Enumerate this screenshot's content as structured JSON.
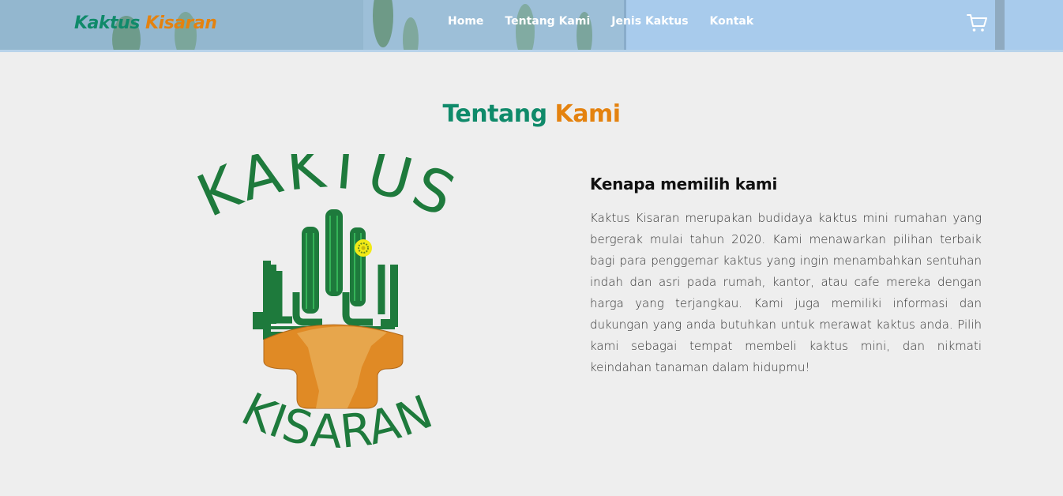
{
  "navbar": {
    "brand_part1": "Kaktus",
    "brand_part2": "Kisaran",
    "links": [
      "Home",
      "Tentang Kami",
      "Jenis Kaktus",
      "Kontak"
    ],
    "cart_icon": "cart-icon"
  },
  "about": {
    "title_part1": "Tentang",
    "title_part2": "Kami",
    "logo": {
      "top_text": "KAKTUS",
      "bottom_text": "KISARAN"
    },
    "heading": "Kenapa memilih kami",
    "paragraph": "Kaktus Kisaran merupakan budidaya kaktus mini rumahan yang bergerak mulai tahun 2020. Kami menawarkan pilihan terbaik bagi para penggemar kaktus yang ingin menambahkan sentuhan indah dan asri pada rumah, kantor, atau cafe mereka dengan harga yang terjangkau. Kami juga memiliki informasi dan dukungan yang anda butuhkan untuk merawat kaktus anda. Pilih kami sebagai tempat membeli kaktus mini, dan nikmati keindahan tanaman dalam hidupmu!"
  },
  "colors": {
    "green": "#0f8a6a",
    "orange": "#e4820f",
    "logo_green": "#1e7a3c",
    "pot_orange": "#e08a25"
  }
}
